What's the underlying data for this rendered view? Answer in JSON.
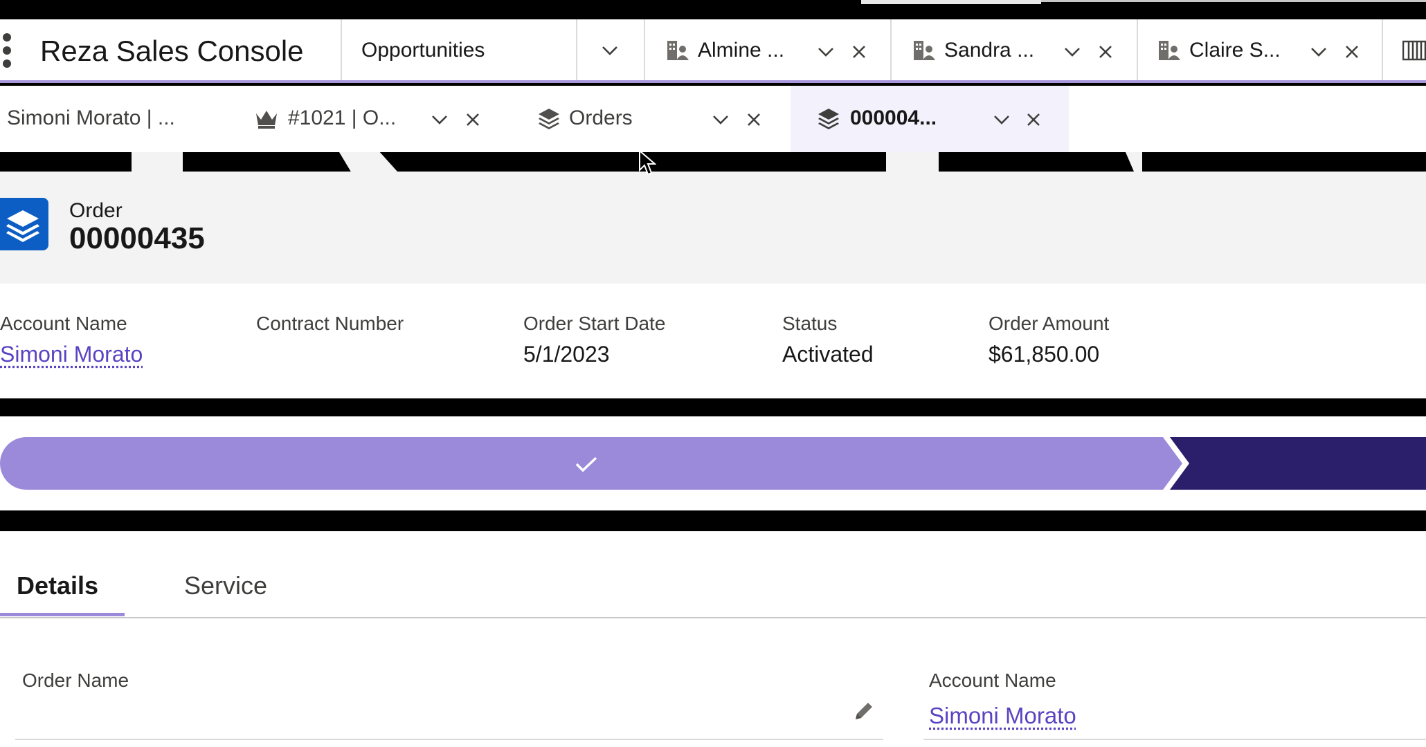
{
  "app": {
    "name": "Reza Sales Console"
  },
  "nav": {
    "object_menu_label": "Opportunities",
    "workspace_tabs": [
      {
        "label": "Almine ...",
        "icon": "account-icon"
      },
      {
        "label": "Sandra ...",
        "icon": "account-icon"
      },
      {
        "label": "Claire S...",
        "icon": "account-icon"
      }
    ],
    "overflow_icon": "columns-icon"
  },
  "subtabs": [
    {
      "label": "Simoni Morato | ...",
      "icon": null,
      "active": false
    },
    {
      "label": "#1021 | O...",
      "icon": "crown-icon",
      "active": false
    },
    {
      "label": "Orders",
      "icon": "stack-icon",
      "active": false
    },
    {
      "label": "000004...",
      "icon": "stack-icon",
      "active": true
    }
  ],
  "record": {
    "object_type": "Order",
    "title": "00000435",
    "icon": "order-stack-icon"
  },
  "highlights": [
    {
      "label": "Account Name",
      "value": "Simoni Morato",
      "link": true
    },
    {
      "label": "Contract Number",
      "value": "",
      "link": false
    },
    {
      "label": "Order Start Date",
      "value": "5/1/2023",
      "link": false
    },
    {
      "label": "Status",
      "value": "Activated",
      "link": false
    },
    {
      "label": "Order Amount",
      "value": "$61,850.00",
      "link": false
    }
  ],
  "path": {
    "completed_icon": "check-icon"
  },
  "detail_tabs": [
    {
      "label": "Details",
      "active": true
    },
    {
      "label": "Service",
      "active": false
    }
  ],
  "fields": {
    "order_name": {
      "label": "Order Name",
      "value": ""
    },
    "account_name": {
      "label": "Account Name",
      "value": "Simoni Morato"
    }
  },
  "colors": {
    "brand_purple": "#9b89da",
    "dark_purple": "#2b1f6b",
    "link": "#5a43c2",
    "record_icon_bg": "#0d5ec4"
  }
}
